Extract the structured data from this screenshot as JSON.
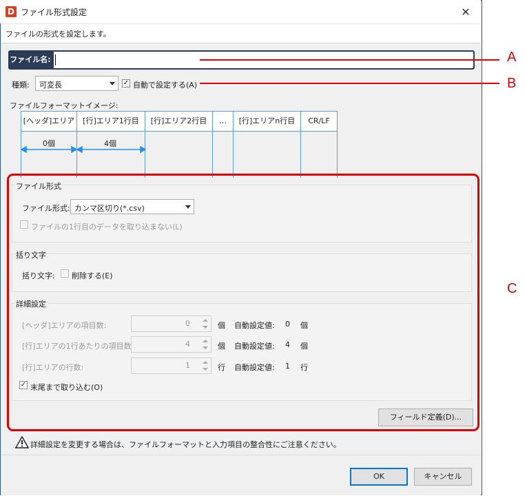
{
  "window": {
    "title": "ファイル形式設定",
    "app_icon_letter": "D",
    "close_glyph": "✕",
    "description": "ファイルの形式を設定します。"
  },
  "filename": {
    "label": "ファイル名:",
    "value": ""
  },
  "kind": {
    "label": "種類:",
    "value": "可変長",
    "auto_label": "自動で設定する(A)",
    "auto_checked": true
  },
  "format_image": {
    "title": "ファイルフォーマットイメージ:",
    "columns": [
      "[ヘッダ]エリア",
      "[行]エリア1行目",
      "[行]エリア2行目",
      "…",
      "[行]エリアn行目",
      "CR/LF"
    ],
    "header_count": "0個",
    "row_count": "4個"
  },
  "file_format_group": {
    "title": "ファイル形式",
    "format_label": "ファイル形式:",
    "format_value": "カンマ区切り(*.csv)",
    "skip_first_label": "ファイルの1行目のデータを取り込まない(L)"
  },
  "quote_group": {
    "title": "括り文字",
    "label": "括り文字:",
    "delete_label": "削除する(E)"
  },
  "detail_group": {
    "title": "詳細設定",
    "rows": [
      {
        "label": "[ヘッダ]エリアの項目数:",
        "value": "0",
        "unit": "個",
        "auto_label": "自動設定値:",
        "auto_value": "0",
        "auto_unit": "個"
      },
      {
        "label": "[行]エリアの1行あたりの項目数:",
        "value": "4",
        "unit": "個",
        "auto_label": "自動設定値:",
        "auto_value": "4",
        "auto_unit": "個"
      },
      {
        "label": "[行]エリアの行数:",
        "value": "1",
        "unit": "行",
        "auto_label": "自動設定値:",
        "auto_value": "1",
        "auto_unit": "行"
      }
    ],
    "read_to_end_label": "末尾まで取り込む(O)",
    "read_to_end_checked": true
  },
  "field_def_button": "フィールド定義(D)...",
  "warning": {
    "icon": "warning-icon",
    "text": "詳細設定を変更する場合は、ファイルフォーマットと入力項目の整合性にご注意ください。"
  },
  "ok_button": "OK",
  "cancel_button": "キャンセル",
  "callouts": {
    "a": "A",
    "b": "B",
    "c": "C"
  },
  "colors": {
    "accent": "#2b3d56",
    "callout": "#e00000",
    "format_border": "#5b9bd5",
    "arrow": "#1e90ff"
  }
}
